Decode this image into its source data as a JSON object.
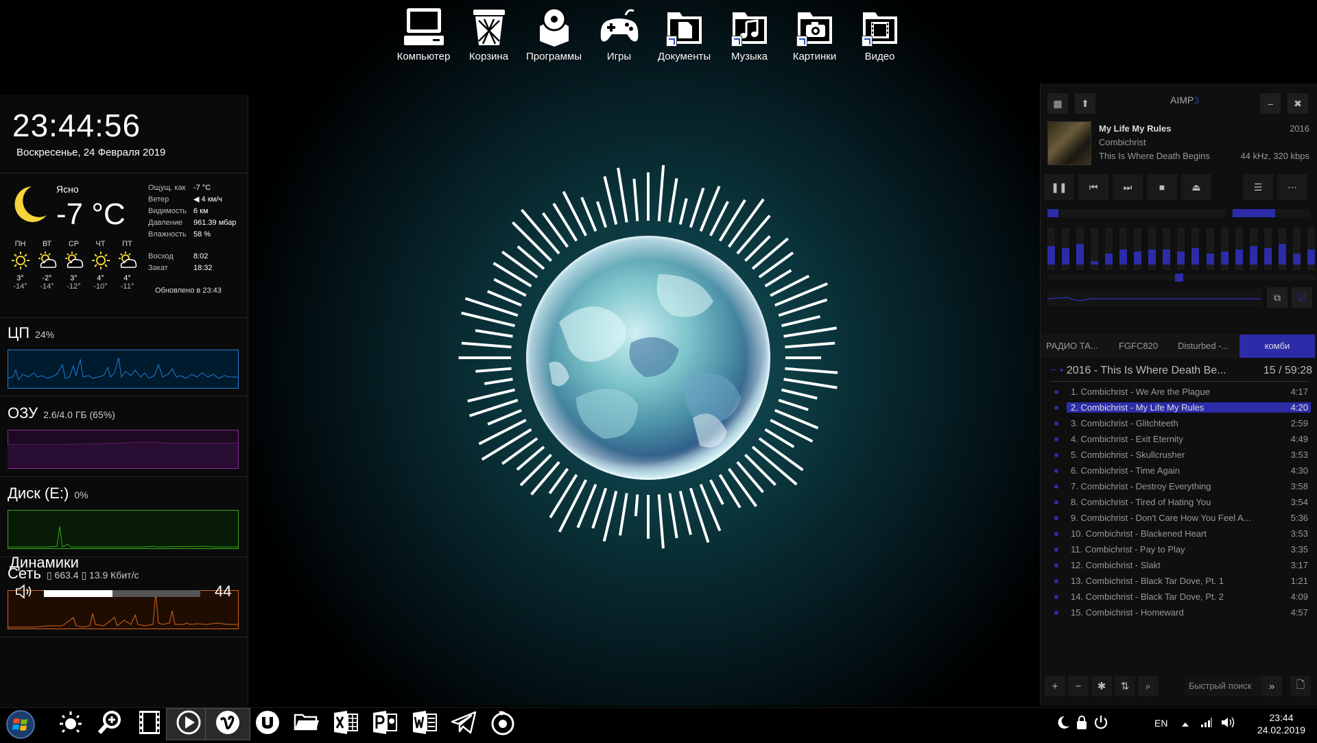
{
  "desktop": {
    "shortcuts": [
      {
        "label": "Компьютер",
        "icon": "computer-icon"
      },
      {
        "label": "Корзина",
        "icon": "recycle-bin-icon"
      },
      {
        "label": "Программы",
        "icon": "programs-icon"
      },
      {
        "label": "Игры",
        "icon": "gamepad-icon"
      },
      {
        "label": "Документы",
        "icon": "documents-icon"
      },
      {
        "label": "Музыка",
        "icon": "music-icon"
      },
      {
        "label": "Картинки",
        "icon": "pictures-icon"
      },
      {
        "label": "Видео",
        "icon": "video-icon"
      }
    ]
  },
  "clock": {
    "time": "23:44:56",
    "date": "Воскресенье, 24 Февраля 2019"
  },
  "weather": {
    "condition": "Ясно",
    "temp": "-7 °C",
    "details": [
      {
        "k": "Ощущ. как",
        "v": "-7 °C"
      },
      {
        "k": "Ветер",
        "v": "4 км/ч"
      },
      {
        "k": "Видимость",
        "v": "6 км"
      },
      {
        "k": "Давление",
        "v": "961.39 мбар"
      },
      {
        "k": "Влажность",
        "v": "58 %"
      }
    ],
    "forecast": [
      {
        "day": "ПН",
        "hi": "3°",
        "lo": "-14°",
        "icon": "sun-icon"
      },
      {
        "day": "ВТ",
        "hi": "-2°",
        "lo": "-14°",
        "icon": "partly-cloudy-icon"
      },
      {
        "day": "СР",
        "hi": "3°",
        "lo": "-12°",
        "icon": "partly-cloudy-icon"
      },
      {
        "day": "ЧТ",
        "hi": "4°",
        "lo": "-10°",
        "icon": "sun-icon"
      },
      {
        "day": "ПТ",
        "hi": "4°",
        "lo": "-11°",
        "icon": "partly-cloudy-icon"
      }
    ],
    "sunrise_label": "Восход",
    "sunrise": "8:02",
    "sunset_label": "Закат",
    "sunset": "18:32",
    "updated": "Обновлено в 23:43"
  },
  "meters": {
    "cpu": {
      "label": "ЦП",
      "value": "24%",
      "color": "#1e7fd4"
    },
    "ram": {
      "label": "ОЗУ",
      "value": "2.6/4.0 ГБ (65%)",
      "color": "#8a2b9c"
    },
    "disk": {
      "label": "Диск (E:)",
      "value": "0%",
      "color": "#3aa81e"
    },
    "net": {
      "label": "Сеть",
      "value": "▯ 663.4 ▯ 13.9 Кбит/с",
      "color": "#d4661e"
    }
  },
  "volume": {
    "label": "Динамики",
    "level_percent": 44,
    "value": "44"
  },
  "aimp": {
    "title_a": "AIMP",
    "title_b": "3",
    "track": {
      "title": "My Life My Rules",
      "year": "2016",
      "artist": "Combichrist",
      "album": "This Is Where Death Begins",
      "info": "44 kHz, 320 kbps"
    },
    "seek_fraction": 0.06,
    "volume_fraction": 0.55,
    "eq_levels": [
      0.5,
      0.45,
      0.55,
      0.1,
      0.3,
      0.4,
      0.35,
      0.4,
      0.4,
      0.35,
      0.45,
      0.3,
      0.35,
      0.4,
      0.5,
      0.45,
      0.55,
      0.3,
      0.4
    ],
    "tabs": [
      "РАДИО ТА...",
      "FGFC820",
      "Disturbed -...",
      "комби"
    ],
    "group": {
      "title": "2016 - This Is Where Death Be...",
      "summary": "15 / 59:28"
    },
    "playlist": [
      {
        "name": "1. Combichrist - We Are the Plague",
        "dur": "4:17"
      },
      {
        "name": "2. Combichrist - My Life My Rules",
        "dur": "4:20",
        "selected": true
      },
      {
        "name": "3. Combichrist - Glitchteeth",
        "dur": "2:59"
      },
      {
        "name": "4. Combichrist - Exit Eternity",
        "dur": "4:49"
      },
      {
        "name": "5. Combichrist - Skullcrusher",
        "dur": "3:53"
      },
      {
        "name": "6. Combichrist - Time Again",
        "dur": "4:30"
      },
      {
        "name": "7. Combichrist - Destroy Everything",
        "dur": "3:58"
      },
      {
        "name": "8. Combichrist - Tired of Hating You",
        "dur": "3:54"
      },
      {
        "name": "9. Combichrist - Don't Care How You Feel A...",
        "dur": "5:36"
      },
      {
        "name": "10. Combichrist - Blackened Heart",
        "dur": "3:53"
      },
      {
        "name": "11. Combichrist - Pay to Play",
        "dur": "3:35"
      },
      {
        "name": "12. Combichrist - Slakt",
        "dur": "3:17"
      },
      {
        "name": "13. Combichrist - Black Tar Dove, Pt. 1",
        "dur": "1:21"
      },
      {
        "name": "14. Combichrist - Black Tar Dove, Pt. 2",
        "dur": "4:09"
      },
      {
        "name": "15. Combichrist - Homeward",
        "dur": "4:57"
      }
    ],
    "quick_search_placeholder": "Быстрый поиск"
  },
  "taskbar": {
    "items": [
      {
        "icon": "weather-sun-icon"
      },
      {
        "icon": "magnifier-icon"
      },
      {
        "icon": "film-strip-icon"
      },
      {
        "icon": "media-player-icon",
        "active": true
      },
      {
        "icon": "vimeo-icon",
        "active": true
      },
      {
        "icon": "utorrent-icon"
      },
      {
        "icon": "folder-icon"
      },
      {
        "icon": "excel-icon"
      },
      {
        "icon": "powerpoint-icon"
      },
      {
        "icon": "word-icon"
      },
      {
        "icon": "telegram-icon"
      },
      {
        "icon": "aimp-icon"
      }
    ],
    "lang": "EN",
    "time": "23:44",
    "date": "24.02.2019"
  }
}
